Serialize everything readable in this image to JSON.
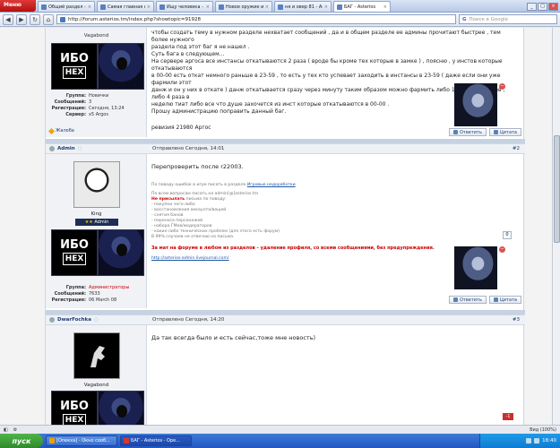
{
  "browser": {
    "menu_label": "Меню",
    "tabs": [
      {
        "label": "Общий раздел - Ast...",
        "active": false
      },
      {
        "label": "Самая главная стра...",
        "active": false
      },
      {
        "label": "Ищу человека - Ast...",
        "active": false
      },
      {
        "label": "Новое оружие и бро...",
        "active": false
      },
      {
        "label": "ня и овер 81 - Asterios",
        "active": false
      },
      {
        "label": "БАГ - Asterios",
        "active": true
      }
    ],
    "url": "http://forum.asterios.tm/index.php?showtopic=91928",
    "search_placeholder": "Поиск в Google"
  },
  "post1": {
    "username": "Vagabond",
    "info": [
      {
        "k": "Группа:",
        "v": "Новички"
      },
      {
        "k": "Сообщений:",
        "v": "3"
      },
      {
        "k": "Регистрация:",
        "v": "Сегодня, 13:24"
      },
      {
        "k": "Сервер:",
        "v": "x5 Argos"
      }
    ],
    "rank_top": "ИБО",
    "rank_bottom": "HEX",
    "body_lines": [
      "чтобы создать тему в нужном разделе нехватает сообщений , да и в общем разделе ее админы прочитают быстрее , тем более нужного",
      "раздела под этот баг я не нашел .",
      "Суть бага в следующем...",
      "На сервере аргоса все инстансы откатываются 2 раза ( вроде бы кроме тех которые в замке ) , поясню , у инстов которые откатываются",
      "в 00-00 есть откат немного раньше в 23-59 , то есть у тех кто успевает заходить в инстансы в 23-59 ( даже если они уже фармили этот",
      "данж и он у них в откате ) данж откатывается сразу через минуту таким образом можно фармить либо 14 раз близнецов , либо 4 раза в",
      "неделю тиат либо все что душе захочется из инст которые откатываются в 00-00 .",
      "Прошу администрацию поправить данный баг."
    ],
    "revision": "ревизия 21980 Аргос",
    "report_label": "Жалоба",
    "reply_label": "Ответить",
    "quote_label": "Цитата"
  },
  "post2": {
    "author": "Admin",
    "date": "Отправлено Сегодня, 14:01",
    "number": "#2",
    "avatar_caption": "King",
    "group_badge": "Admin",
    "rank_top": "ИБО",
    "rank_bottom": "HEX",
    "info": [
      {
        "k": "Группа:",
        "v": "Администраторы",
        "red": true
      },
      {
        "k": "Сообщений:",
        "v": "7633",
        "red": false
      },
      {
        "k": "Регистрация:",
        "v": "06 March 08",
        "red": false
      }
    ],
    "message": "Перепроверить после r22003.",
    "faq_intro": "По поводу ошибок в игре писать в разделе",
    "faq_link": "Игровые недоработки",
    "faq_contact": "По всем вопросам писать на admin[@]asterios.tm",
    "faq_not_label": "Не присылать",
    "faq_not_rest": "письма по поводу:",
    "faq_items": [
      "- покупки чего-либо",
      "- восстановления аккаунта/вещей",
      "- снятия банов",
      "- переноса персонажей",
      "- набора ГМов/модераторов",
      "- каких-либо технических проблем (для этого есть форум)",
      "В 99% случаев не отвечаю на письма."
    ],
    "faq_warning": "За мат на форуме в любом из разделов – удаление профиля, со всеми сообщениями, без предупреждения.",
    "faq_url": "http://asterios-admin.livejournal.com/",
    "counter": "0",
    "reply_label": "Ответить",
    "quote_label": "Цитата"
  },
  "post3": {
    "author": "DwarFochka",
    "date": "Отправлено Сегодня, 14:20",
    "number": "#3",
    "avatar_caption": "Vagabond",
    "message": "Да так всегда было и есть сейчас,тоже мне новость)",
    "rank_top": "ИБО",
    "rank_bottom": "HEX",
    "badge": "-1"
  },
  "status": {
    "zoom": "Вид (100%)"
  },
  "taskbar": {
    "start_label": "пуск",
    "tasks": [
      {
        "label": "[Опекха] - Окно сооб...",
        "active": false
      },
      {
        "label": "БАГ - Asterios - Ope...",
        "active": true
      }
    ],
    "clock": "18:40"
  }
}
